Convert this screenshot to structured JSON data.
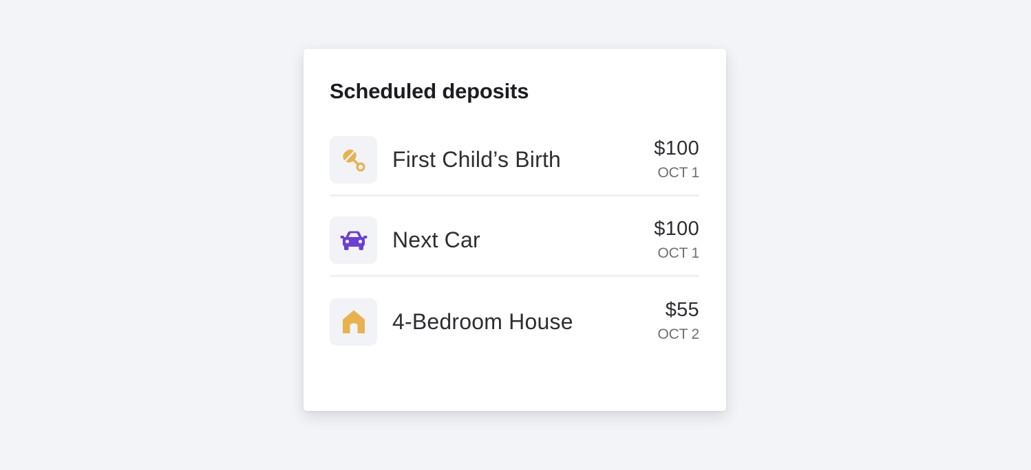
{
  "card": {
    "title": "Scheduled deposits"
  },
  "deposits": [
    {
      "label": "First Child’s Birth",
      "amount": "$100",
      "date": "OCT 1",
      "icon": "baby-rattle-icon",
      "icon_color": "#e8b24f"
    },
    {
      "label": "Next Car",
      "amount": "$100",
      "date": "OCT 1",
      "icon": "car-icon",
      "icon_color": "#6a3fd6"
    },
    {
      "label": "4-Bedroom House",
      "amount": "$55",
      "date": "OCT 2",
      "icon": "house-icon",
      "icon_color": "#e8b24f"
    }
  ],
  "colors": {
    "background": "#f3f4f7",
    "card": "#ffffff",
    "icon_tile": "#f2f3f6"
  }
}
